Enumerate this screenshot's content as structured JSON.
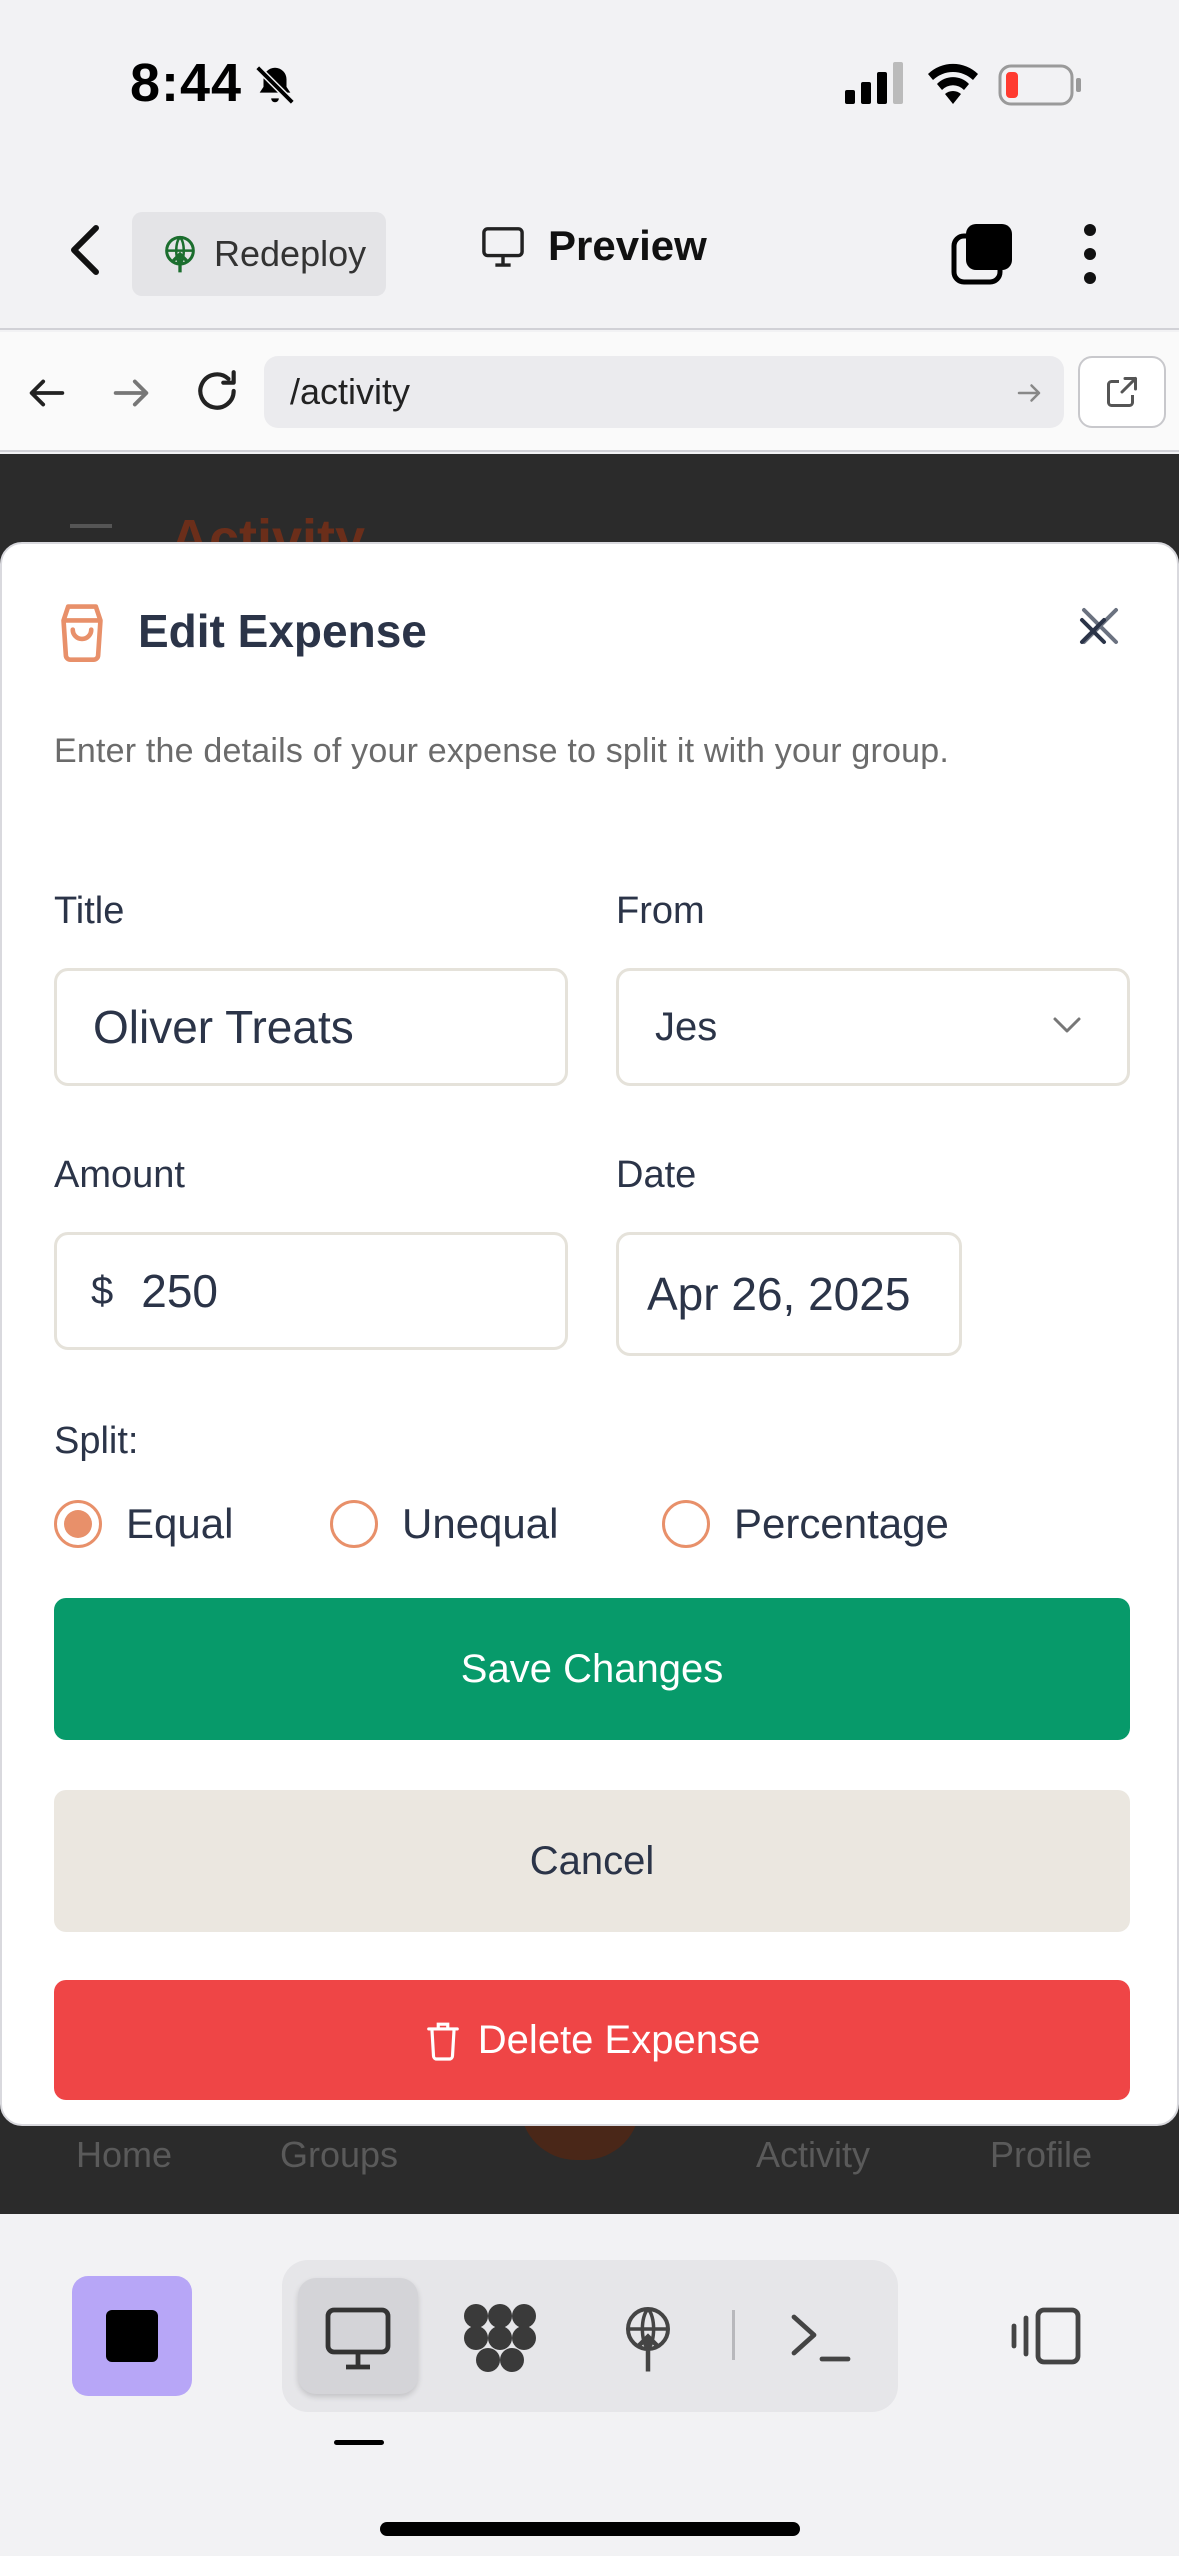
{
  "status_bar": {
    "time": "8:44"
  },
  "header": {
    "redeploy_label": "Redeploy",
    "preview_label": "Preview"
  },
  "url_bar": {
    "path": "/activity"
  },
  "background_page": {
    "title": "Activity",
    "tabs": [
      "Home",
      "Groups",
      "Activity",
      "Profile"
    ]
  },
  "modal": {
    "title": "Edit Expense",
    "description": "Enter the details of your expense to split it with your group.",
    "title_label": "Title",
    "title_value": "Oliver Treats",
    "from_label": "From",
    "from_value": "Jes",
    "amount_label": "Amount",
    "currency_symbol": "$",
    "amount_value": "250",
    "date_label": "Date",
    "date_value": "Apr 26, 2025",
    "split_label": "Split:",
    "split_options": [
      {
        "label": "Equal",
        "selected": true
      },
      {
        "label": "Unequal",
        "selected": false
      },
      {
        "label": "Percentage",
        "selected": false
      }
    ],
    "save_label": "Save Changes",
    "cancel_label": "Cancel",
    "delete_label": "Delete Expense"
  },
  "toolbar": {
    "icons": [
      "stop-icon",
      "monitor-icon",
      "cluster-icon",
      "deploy-icon",
      "terminal-icon",
      "split-view-icon"
    ]
  },
  "colors": {
    "accent_orange": "#e8906a",
    "save_green": "#079a6a",
    "delete_red": "#ef4546",
    "cancel_beige": "#ebe7e0",
    "stop_purple": "#b7a6f7"
  }
}
